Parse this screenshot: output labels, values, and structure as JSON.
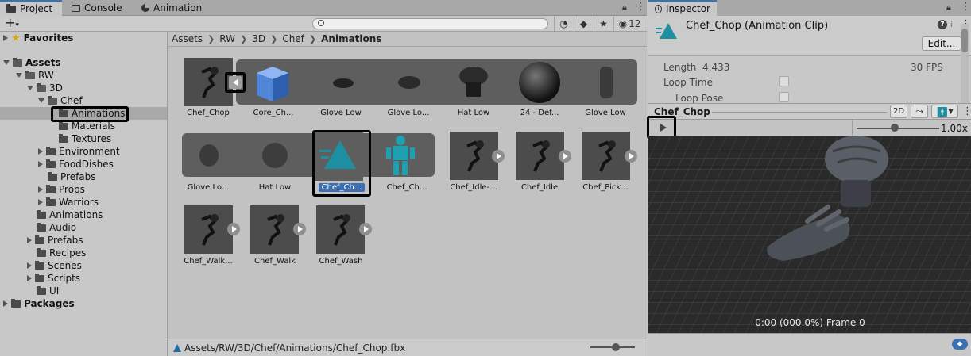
{
  "project": {
    "tabs": [
      {
        "label": "Project",
        "icon": "folder-icon"
      },
      {
        "label": "Console",
        "icon": "console-icon"
      },
      {
        "label": "Animation",
        "icon": "animation-icon"
      }
    ],
    "toolbar": {
      "add_label": "+",
      "hidden_count": "12"
    },
    "tree": {
      "favorites": "Favorites",
      "assets": "Assets",
      "rw": "RW",
      "d3": "3D",
      "chef": "Chef",
      "animations": "Animations",
      "materials": "Materials",
      "textures": "Textures",
      "environment": "Environment",
      "fooddishes": "FoodDishes",
      "prefabs_sub": "Prefabs",
      "props": "Props",
      "warriors": "Warriors",
      "animations_top": "Animations",
      "audio": "Audio",
      "prefabs": "Prefabs",
      "recipes": "Recipes",
      "scenes": "Scenes",
      "scripts": "Scripts",
      "ui": "UI",
      "packages": "Packages"
    },
    "breadcrumb": [
      "Assets",
      "RW",
      "3D",
      "Chef",
      "Animations"
    ],
    "assets": {
      "row1": [
        "Chef_Chop",
        "Core_Ch...",
        "Glove Low",
        "Glove Lo...",
        "Hat Low",
        "24 - Def...",
        "Glove Low"
      ],
      "row2": [
        "Glove Lo...",
        "Hat Low",
        "Chef_Ch...",
        "Chef_Ch...",
        "Chef_Idle-...",
        "Chef_Idle",
        "Chef_Pick..."
      ],
      "row3": [
        "Chef_Walk...",
        "Chef_Walk",
        "Chef_Wash"
      ]
    },
    "status_path": "Assets/RW/3D/Chef/Animations/Chef_Chop.fbx"
  },
  "inspector": {
    "tab_label": "Inspector",
    "title": "Chef_Chop (Animation Clip)",
    "edit_label": "Edit...",
    "length_label": "Length",
    "length_value": "4.433",
    "fps": "30 FPS",
    "loop_time_label": "Loop Time",
    "loop_pose_label": "Loop Pose",
    "preview_title": "Chef_Chop",
    "mode_2d": "2D",
    "speed": "1.00x",
    "time_readout": "0:00 (000.0%) Frame 0"
  },
  "colors": {
    "accent": "#3a6fb5",
    "teal": "#1e8fa0",
    "viewport_bg": "#2a2a2a"
  }
}
